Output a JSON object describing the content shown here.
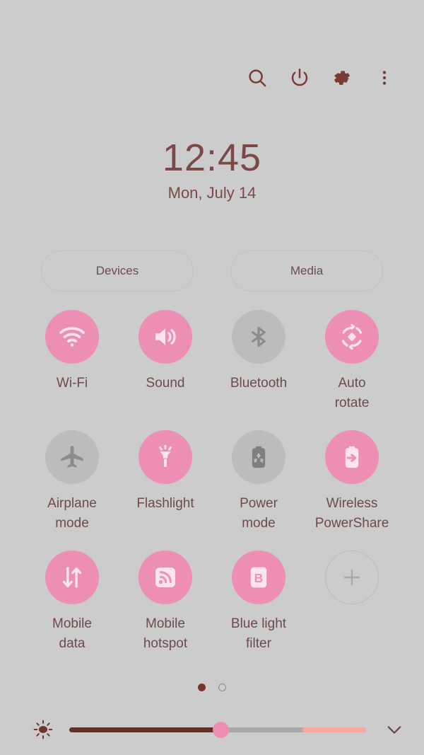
{
  "colors": {
    "background": "#cccccc",
    "accent_pink": "#ed8fb4",
    "inactive_gray": "#bcbcbc",
    "text_maroon": "#6d4b4b",
    "clock_maroon": "#7b4a48",
    "slider_fill": "#5e3027",
    "slider_tail": "#f5a9a0"
  },
  "topbar": {
    "icons": [
      {
        "name": "search-icon",
        "label": "Search"
      },
      {
        "name": "power-icon",
        "label": "Power off"
      },
      {
        "name": "gear-icon",
        "label": "Settings"
      },
      {
        "name": "more-vert-icon",
        "label": "More options"
      }
    ]
  },
  "status": {
    "time": "12:45",
    "date": "Mon, July 14"
  },
  "pills": [
    {
      "label": "Devices",
      "name": "devices-button"
    },
    {
      "label": "Media",
      "name": "media-button"
    }
  ],
  "tiles": [
    {
      "label": "Wi-Fi",
      "name": "toggle-wifi",
      "icon": "wifi-icon",
      "state": "on"
    },
    {
      "label": "Sound",
      "name": "toggle-sound",
      "icon": "sound-icon",
      "state": "on"
    },
    {
      "label": "Bluetooth",
      "name": "toggle-bluetooth",
      "icon": "bluetooth-icon",
      "state": "off"
    },
    {
      "label": "Auto\nrotate",
      "name": "toggle-auto-rotate",
      "icon": "auto-rotate-icon",
      "state": "on"
    },
    {
      "label": "Airplane\nmode",
      "name": "toggle-airplane-mode",
      "icon": "airplane-icon",
      "state": "off"
    },
    {
      "label": "Flashlight",
      "name": "toggle-flashlight",
      "icon": "flashlight-icon",
      "state": "on"
    },
    {
      "label": "Power\nmode",
      "name": "toggle-power-mode",
      "icon": "power-mode-icon",
      "state": "off"
    },
    {
      "label": "Wireless\nPowerShare",
      "name": "toggle-wireless-powershare",
      "icon": "power-share-icon",
      "state": "on"
    },
    {
      "label": "Mobile\ndata",
      "name": "toggle-mobile-data",
      "icon": "mobile-data-icon",
      "state": "on"
    },
    {
      "label": "Mobile\nhotspot",
      "name": "toggle-mobile-hotspot",
      "icon": "hotspot-icon",
      "state": "on"
    },
    {
      "label": "Blue light\nfilter",
      "name": "toggle-blue-light-filter",
      "icon": "blue-light-icon",
      "state": "on"
    },
    {
      "label": "",
      "name": "add-tile-button",
      "icon": "plus-icon",
      "state": "add"
    }
  ],
  "pager": {
    "pages": 2,
    "current": 1
  },
  "brightness": {
    "icon": "brightness-sun-icon",
    "value_percent": 48,
    "expand_icon": "chevron-down-icon"
  }
}
